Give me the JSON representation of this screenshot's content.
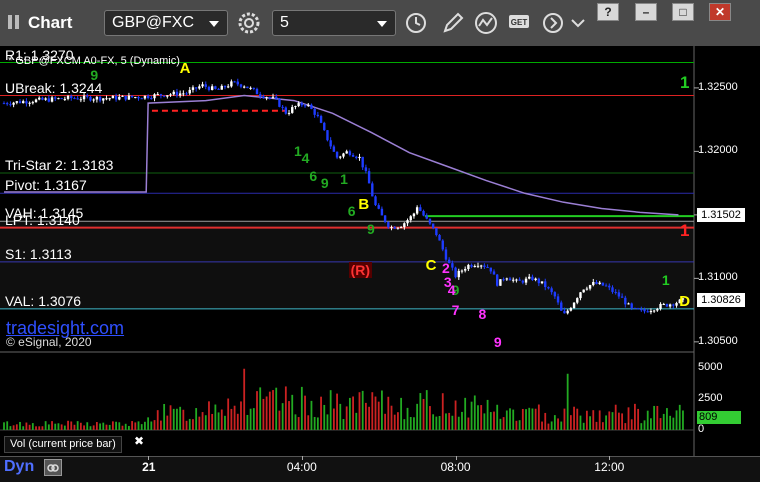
{
  "window": {
    "app_title": "Chart",
    "symbol": "GBP@FXC",
    "interval": "5",
    "win_buttons": [
      "?",
      "–",
      "□",
      "✕"
    ]
  },
  "chart_info": {
    "symbol_label": "* GBP@FXCM A0-FX, 5 (Dynamic)",
    "brand": "tradesight.com",
    "copyright": "© eSignal, 2020"
  },
  "levels": [
    {
      "key": "r1",
      "label": "R1: 1.3270",
      "price": 1.327,
      "color": "#00aa00"
    },
    {
      "key": "ubreak",
      "label": "UBreak: 1.3244",
      "price": 1.3244,
      "color": "#dd2222"
    },
    {
      "key": "tristar",
      "label": "Tri-Star 2: 1.3183",
      "price": 1.3183,
      "color": "#0f5f0f"
    },
    {
      "key": "pivot",
      "label": "Pivot: 1.3167",
      "price": 1.3167,
      "color": "#2a2aaa"
    },
    {
      "key": "vah",
      "label": "VAH: 1.3145",
      "price": 1.3145,
      "color": "#999999"
    },
    {
      "key": "lpt",
      "label": "LPT: 1.3140",
      "price": 1.314,
      "color": "#dd2222"
    },
    {
      "key": "s1",
      "label": "S1: 1.3113",
      "price": 1.3113,
      "color": "#2a2aaa"
    },
    {
      "key": "val",
      "label": "VAL: 1.3076",
      "price": 1.3076,
      "color": "#3ab7c8"
    }
  ],
  "chart_data": {
    "type": "candlestick",
    "price_axis": {
      "ticks": [
        "1.32500",
        "1.32000",
        "1.31500",
        "1.31000",
        "1.30500"
      ],
      "tick_values": [
        1.325,
        1.32,
        1.315,
        1.31,
        1.305
      ],
      "min": 1.3042,
      "max": 1.3283,
      "current_labels": [
        {
          "value": 1.31502,
          "text": "1.31502"
        },
        {
          "value": 1.30826,
          "text": "1.30826"
        }
      ]
    },
    "x_axis": {
      "ticks": [
        {
          "label": "21",
          "hour": 0
        },
        {
          "label": "04:00",
          "hour": 4
        },
        {
          "label": "08:00",
          "hour": 8
        },
        {
          "label": "12:00",
          "hour": 12
        }
      ],
      "start_hour": -3.75,
      "end_hour": 14.1
    },
    "price_path": [
      [
        -3.75,
        1.3238
      ],
      [
        -3.0,
        1.324
      ],
      [
        -2.0,
        1.3242
      ],
      [
        -1.0,
        1.3242
      ],
      [
        -0.2,
        1.3243
      ],
      [
        0.5,
        1.3245
      ],
      [
        1.0,
        1.3246
      ],
      [
        1.4,
        1.3252
      ],
      [
        1.8,
        1.3248
      ],
      [
        2.2,
        1.3254
      ],
      [
        2.5,
        1.3252
      ],
      [
        2.9,
        1.3245
      ],
      [
        3.3,
        1.3241
      ],
      [
        3.6,
        1.323
      ],
      [
        3.8,
        1.3235
      ],
      [
        4.1,
        1.3238
      ],
      [
        4.4,
        1.3228
      ],
      [
        4.6,
        1.3214
      ],
      [
        4.9,
        1.3195
      ],
      [
        5.2,
        1.32
      ],
      [
        5.5,
        1.3195
      ],
      [
        5.7,
        1.318
      ],
      [
        5.9,
        1.3158
      ],
      [
        6.1,
        1.3148
      ],
      [
        6.3,
        1.314
      ],
      [
        6.6,
        1.3142
      ],
      [
        6.9,
        1.315
      ],
      [
        7.0,
        1.3157
      ],
      [
        7.2,
        1.3148
      ],
      [
        7.5,
        1.3135
      ],
      [
        7.8,
        1.3113
      ],
      [
        8.0,
        1.3102
      ],
      [
        8.3,
        1.311
      ],
      [
        8.6,
        1.3112
      ],
      [
        8.9,
        1.3108
      ],
      [
        9.1,
        1.3095
      ],
      [
        9.3,
        1.3102
      ],
      [
        9.6,
        1.3097
      ],
      [
        10.0,
        1.31
      ],
      [
        10.3,
        1.3095
      ],
      [
        10.6,
        1.3085
      ],
      [
        10.8,
        1.307
      ],
      [
        11.0,
        1.3078
      ],
      [
        11.3,
        1.3092
      ],
      [
        11.6,
        1.3096
      ],
      [
        11.9,
        1.3094
      ],
      [
        12.3,
        1.3085
      ],
      [
        12.6,
        1.3075
      ],
      [
        12.9,
        1.3074
      ],
      [
        13.3,
        1.3078
      ],
      [
        13.6,
        1.308
      ],
      [
        14.0,
        1.3083
      ]
    ],
    "moving_average": [
      [
        -3.75,
        1.3168
      ],
      [
        -0.05,
        1.3168
      ],
      [
        0.0,
        1.3238
      ],
      [
        1.5,
        1.324
      ],
      [
        2.5,
        1.3244
      ],
      [
        3.8,
        1.324
      ],
      [
        4.8,
        1.323
      ],
      [
        5.8,
        1.3215
      ],
      [
        6.8,
        1.3199
      ],
      [
        7.8,
        1.3188
      ],
      [
        8.8,
        1.3177
      ],
      [
        9.8,
        1.3167
      ],
      [
        10.8,
        1.316
      ],
      [
        11.8,
        1.3155
      ],
      [
        12.8,
        1.3152
      ],
      [
        13.8,
        1.315
      ]
    ],
    "volume_axis": {
      "ticks": [
        "5000",
        "2500",
        "0"
      ],
      "tick_values": [
        5000,
        2500,
        0
      ],
      "max": 5600
    },
    "volume_current": "809",
    "volume_label": "Vol (current price bar)",
    "annotations": [
      {
        "text": "A",
        "hour": 0.95,
        "price": 1.3265,
        "color": "#ffff00"
      },
      {
        "text": "B",
        "hour": 5.6,
        "price": 1.3158,
        "color": "#ffff00"
      },
      {
        "text": "C",
        "hour": 7.35,
        "price": 1.311,
        "color": "#ffff00"
      },
      {
        "text": "D",
        "hour": 13.95,
        "price": 1.3081,
        "color": "#ffff00"
      }
    ],
    "markers": [
      {
        "text": "(R)",
        "hour": 5.4,
        "price": 1.3106,
        "color": "#ff3333",
        "bg": "#550000"
      },
      {
        "text": "1",
        "hour": 13.55,
        "price": 1.3098,
        "color": "#22cc22"
      }
    ],
    "counts_green": [
      {
        "text": "9",
        "hour": -1.4,
        "price": 1.326
      },
      {
        "text": "1",
        "hour": 3.9,
        "price": 1.32
      },
      {
        "text": "4",
        "hour": 4.1,
        "price": 1.3195
      },
      {
        "text": "6",
        "hour": 4.3,
        "price": 1.3181
      },
      {
        "text": "9",
        "hour": 4.6,
        "price": 1.3175
      },
      {
        "text": "1",
        "hour": 5.1,
        "price": 1.3178
      },
      {
        "text": "6",
        "hour": 5.3,
        "price": 1.3153
      },
      {
        "text": "9",
        "hour": 5.8,
        "price": 1.3139
      },
      {
        "text": "9",
        "hour": 8.0,
        "price": 1.3091
      }
    ],
    "counts_magenta": [
      {
        "text": "2",
        "hour": 7.75,
        "price": 1.3108
      },
      {
        "text": "3",
        "hour": 7.8,
        "price": 1.3097
      },
      {
        "text": "4",
        "hour": 7.9,
        "price": 1.3091
      },
      {
        "text": "7",
        "hour": 8.0,
        "price": 1.3075
      },
      {
        "text": "8",
        "hour": 8.7,
        "price": 1.3072
      },
      {
        "text": "9",
        "hour": 9.1,
        "price": 1.305
      }
    ],
    "right_flags": [
      {
        "text": "1",
        "price": 1.3255,
        "color": "#22cc22"
      },
      {
        "text": "1",
        "price": 1.3138,
        "color": "#ff2222"
      }
    ]
  }
}
